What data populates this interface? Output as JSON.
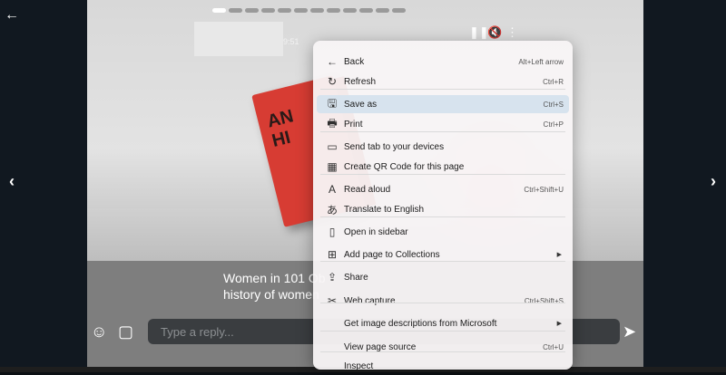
{
  "story": {
    "time": "9:51",
    "book_text": "AN\nHI",
    "caption": "Women in 101 Ob\nhistory of women",
    "reply_placeholder": "Type a reply...",
    "progress_active": 1,
    "progress_total": 12
  },
  "menu": [
    {
      "icon": "←",
      "label": "Back",
      "shortcut": "Alt+Left arrow"
    },
    {
      "icon": "↻",
      "label": "Refresh",
      "shortcut": "Ctrl+R"
    },
    {
      "icon": "🖫",
      "label": "Save as",
      "shortcut": "Ctrl+S",
      "highlighted": true
    },
    {
      "icon": "🖶",
      "label": "Print",
      "shortcut": "Ctrl+P"
    },
    {
      "icon": "▭",
      "label": "Send tab to your devices",
      "shortcut": ""
    },
    {
      "icon": "▦",
      "label": "Create QR Code for this page",
      "shortcut": ""
    },
    {
      "icon": "A",
      "label": "Read aloud",
      "shortcut": "Ctrl+Shift+U"
    },
    {
      "icon": "あ",
      "label": "Translate to English",
      "shortcut": ""
    },
    {
      "icon": "▯",
      "label": "Open in sidebar",
      "shortcut": ""
    },
    {
      "icon": "⊞",
      "label": "Add page to Collections",
      "shortcut": "",
      "submenu": true
    },
    {
      "icon": "⇪",
      "label": "Share",
      "shortcut": ""
    },
    {
      "icon": "✂",
      "label": "Web capture",
      "shortcut": "Ctrl+Shift+S"
    },
    {
      "icon": "",
      "label": "Get image descriptions from Microsoft",
      "shortcut": "",
      "submenu": true
    },
    {
      "icon": "",
      "label": "View page source",
      "shortcut": "Ctrl+U"
    },
    {
      "icon": "",
      "label": "Inspect",
      "shortcut": ""
    }
  ]
}
